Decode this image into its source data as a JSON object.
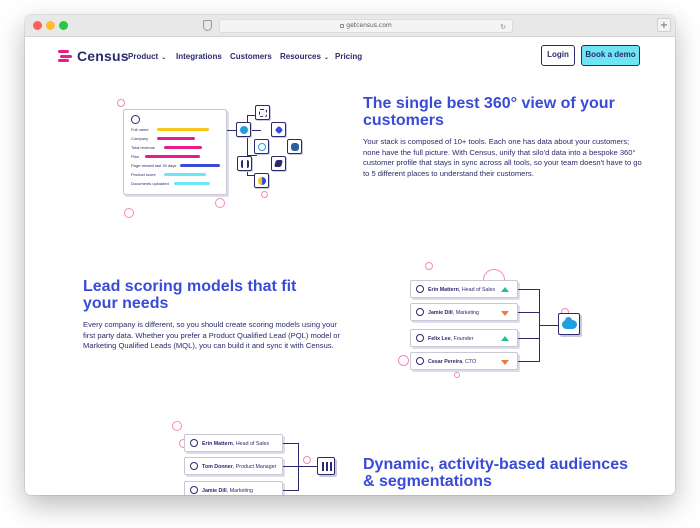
{
  "browser": {
    "url": "getcensus.com",
    "new_tab_label": "+",
    "reload_glyph": "↻"
  },
  "nav": {
    "brand": "Census",
    "items": [
      {
        "label": "Product",
        "has_dropdown": true
      },
      {
        "label": "Integrations",
        "has_dropdown": false
      },
      {
        "label": "Customers",
        "has_dropdown": false
      },
      {
        "label": "Resources",
        "has_dropdown": true
      },
      {
        "label": "Pricing",
        "has_dropdown": false
      }
    ],
    "dropdown_glyph": "⌄",
    "login": "Login",
    "demo": "Book a demo"
  },
  "section1": {
    "heading_line1": "The single best 360° view of your",
    "heading_line2": "customers",
    "body": "Your stack is composed of 10+ tools. Each one has data about your customers; none have the full picture. With Census, unify that silo'd data into a bespoke 360° customer profile that stays in sync across all tools, so your team doesn't have to go to 5 different places to understand their customers.",
    "profile_fields": [
      "Full name",
      "Company",
      "Total revenue",
      "Plan",
      "Page viewed last 30 days",
      "Product score",
      "Documents uploaded"
    ]
  },
  "section2": {
    "heading_line1": "Lead scoring models that fit",
    "heading_line2": "your needs",
    "body": "Every company is different, so you should create scoring models using your first party data. Whether you prefer a Product Qualified Lead (PQL) model or Marketing Qualified Leads (MQL), you can build it and sync it with Census.",
    "leads": [
      {
        "name": "Erin Mattern",
        "title": "Head of Sales",
        "trend": "up"
      },
      {
        "name": "Jamie Dill",
        "title": "Marketing",
        "trend": "down"
      },
      {
        "name": "Felix Lee",
        "title": "Founder",
        "trend": "up"
      },
      {
        "name": "Cesar Pereira",
        "title": "CTO",
        "trend": "down"
      }
    ]
  },
  "section3": {
    "heading_line1": "Dynamic, activity-based audiences",
    "heading_line2": "& segmentations",
    "people": [
      {
        "name": "Erin Mattern",
        "title": "Head of Sales"
      },
      {
        "name": "Tom Donner",
        "title": "Product Manager"
      },
      {
        "name": "Jamie Dill",
        "title": "Marketing"
      }
    ]
  },
  "colors": {
    "brand_navy": "#2b2a6e",
    "heading_blue": "#3a4bd6",
    "accent_pink": "#e61c8a",
    "demo_button": "#6ee6f2",
    "trend_up": "#22c28e",
    "trend_down": "#f07a3a"
  }
}
